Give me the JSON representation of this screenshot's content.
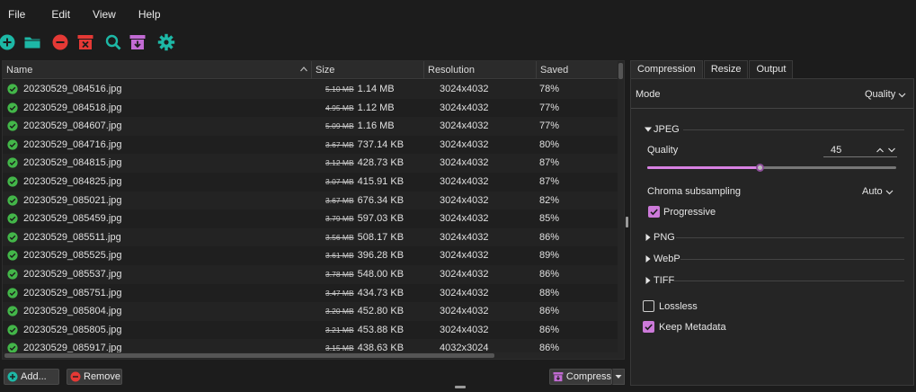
{
  "menu": [
    "File",
    "Edit",
    "View",
    "Help"
  ],
  "toolbar": {
    "icons": [
      "add-files-icon",
      "open-folder-icon",
      "remove-icon",
      "clear-all-icon",
      "search-icon",
      "output-folder-icon",
      "settings-icon"
    ],
    "colors": {
      "teal": "#1db8a6",
      "red": "#e53935",
      "purple": "#c26bd4"
    }
  },
  "table": {
    "headers": {
      "name": "Name",
      "size": "Size",
      "resolution": "Resolution",
      "saved": "Saved"
    },
    "rows": [
      {
        "name": "20230529_084516.jpg",
        "orig": "5.10 MB",
        "size": "1.14 MB",
        "res": "3024x4032",
        "saved": "78%"
      },
      {
        "name": "20230529_084518.jpg",
        "orig": "4.95 MB",
        "size": "1.12 MB",
        "res": "3024x4032",
        "saved": "77%"
      },
      {
        "name": "20230529_084607.jpg",
        "orig": "5.09 MB",
        "size": "1.16 MB",
        "res": "3024x4032",
        "saved": "77%"
      },
      {
        "name": "20230529_084716.jpg",
        "orig": "3.67 MB",
        "size": "737.14 KB",
        "res": "3024x4032",
        "saved": "80%"
      },
      {
        "name": "20230529_084815.jpg",
        "orig": "3.12 MB",
        "size": "428.73 KB",
        "res": "3024x4032",
        "saved": "87%"
      },
      {
        "name": "20230529_084825.jpg",
        "orig": "3.07 MB",
        "size": "415.91 KB",
        "res": "3024x4032",
        "saved": "87%"
      },
      {
        "name": "20230529_085021.jpg",
        "orig": "3.67 MB",
        "size": "676.34 KB",
        "res": "3024x4032",
        "saved": "82%"
      },
      {
        "name": "20230529_085459.jpg",
        "orig": "3.79 MB",
        "size": "597.03 KB",
        "res": "3024x4032",
        "saved": "85%"
      },
      {
        "name": "20230529_085511.jpg",
        "orig": "3.56 MB",
        "size": "508.17 KB",
        "res": "3024x4032",
        "saved": "86%"
      },
      {
        "name": "20230529_085525.jpg",
        "orig": "3.61 MB",
        "size": "396.28 KB",
        "res": "3024x4032",
        "saved": "89%"
      },
      {
        "name": "20230529_085537.jpg",
        "orig": "3.78 MB",
        "size": "548.00 KB",
        "res": "3024x4032",
        "saved": "86%"
      },
      {
        "name": "20230529_085751.jpg",
        "orig": "3.47 MB",
        "size": "434.73 KB",
        "res": "3024x4032",
        "saved": "88%"
      },
      {
        "name": "20230529_085804.jpg",
        "orig": "3.20 MB",
        "size": "452.80 KB",
        "res": "3024x4032",
        "saved": "86%"
      },
      {
        "name": "20230529_085805.jpg",
        "orig": "3.21 MB",
        "size": "453.88 KB",
        "res": "3024x4032",
        "saved": "86%"
      },
      {
        "name": "20230529_085917.jpg",
        "orig": "3.15 MB",
        "size": "438.63 KB",
        "res": "4032x3024",
        "saved": "86%"
      }
    ]
  },
  "buttons": {
    "add": "Add...",
    "remove": "Remove",
    "compress": "Compress"
  },
  "tabs": [
    "Compression",
    "Resize",
    "Output"
  ],
  "settings": {
    "mode_label": "Mode",
    "mode_value": "Quality",
    "jpeg": "JPEG",
    "quality_label": "Quality",
    "quality_value": "45",
    "quality_level": 45,
    "chroma_label": "Chroma subsampling",
    "chroma_value": "Auto",
    "progressive": "Progressive",
    "png": "PNG",
    "webp": "WebP",
    "tiff": "TIFF",
    "lossless": "Lossless",
    "keep_metadata": "Keep Metadata"
  }
}
